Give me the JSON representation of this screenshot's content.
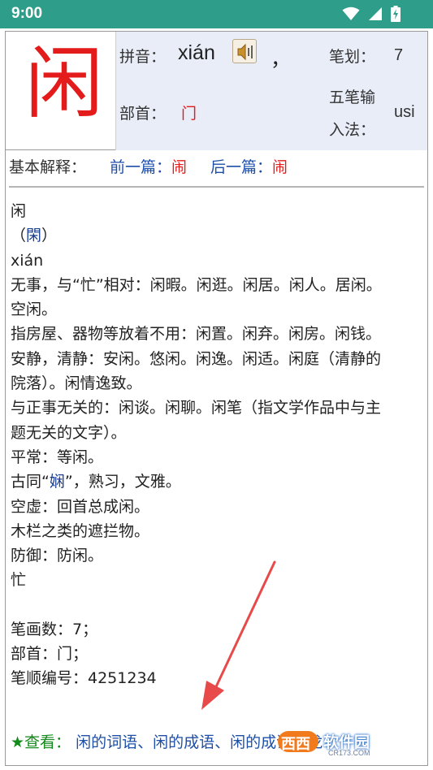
{
  "status_bar": {
    "time": "9:00",
    "icons": [
      "wifi-icon",
      "signal-icon",
      "battery-charging-icon"
    ]
  },
  "char_header": {
    "character": "闲",
    "pinyin_label": "拼音：",
    "pinyin": "xián",
    "pinyin_trailing": "，",
    "radical_label": "部首：",
    "radical": "门",
    "strokes_label": "笔划：",
    "strokes": "7",
    "wubi_label_line1": "五笔输",
    "wubi_label_line2": "入法：",
    "wubi": "usi"
  },
  "nav": {
    "basic_label": "基本解释：",
    "prev_label": "前一篇：",
    "prev_char": "闹",
    "next_label": "后一篇：",
    "next_char": "闹"
  },
  "definition": {
    "headword": "闲",
    "variant_open": "（",
    "variant": "閑",
    "variant_close": "）",
    "pinyin": "xián",
    "meanings": [
      "无事，与“忙”相对：闲暇。闲逛。闲居。闲人。居闲。",
      "空闲。",
      "指房屋、器物等放着不用：闲置。闲弃。闲房。闲钱。",
      "安静，清静：安闲。悠闲。闲逸。闲适。闲庭（清静的",
      "院落）。闲情逸致。",
      "与正事无关的：闲谈。闲聊。闲笔（指文学作品中与主",
      "题无关的文字）。",
      "平常：等闲。"
    ],
    "ancient_prefix": "古同“",
    "ancient_link": "娴",
    "ancient_suffix": "”，熟习，文雅。",
    "meanings_tail": [
      "空虚：回首总成闲。",
      "木栏之类的遮拦物。",
      "防御：防闲。"
    ],
    "antonym": "忙"
  },
  "stats": {
    "strokes": "笔画数：7；",
    "radical": "部首：门；",
    "order": "笔顺编号：4251234"
  },
  "see_more": {
    "label": "★查看：",
    "link_words": "闲的词语",
    "sep1": "、",
    "link_idioms": "闲的成语",
    "sep2": "、",
    "link_third": "闲的成语接龙"
  },
  "watermark": {
    "pill": "西西",
    "text": "软件园",
    "url": "CR173.COM"
  },
  "colors": {
    "status_bar": "#2e9d8a",
    "header_bg": "#e8edf8",
    "accent_red": "#e31b1b",
    "link_blue": "#1e4fa8",
    "green": "#138a1b",
    "arrow": "#e84a4a"
  }
}
